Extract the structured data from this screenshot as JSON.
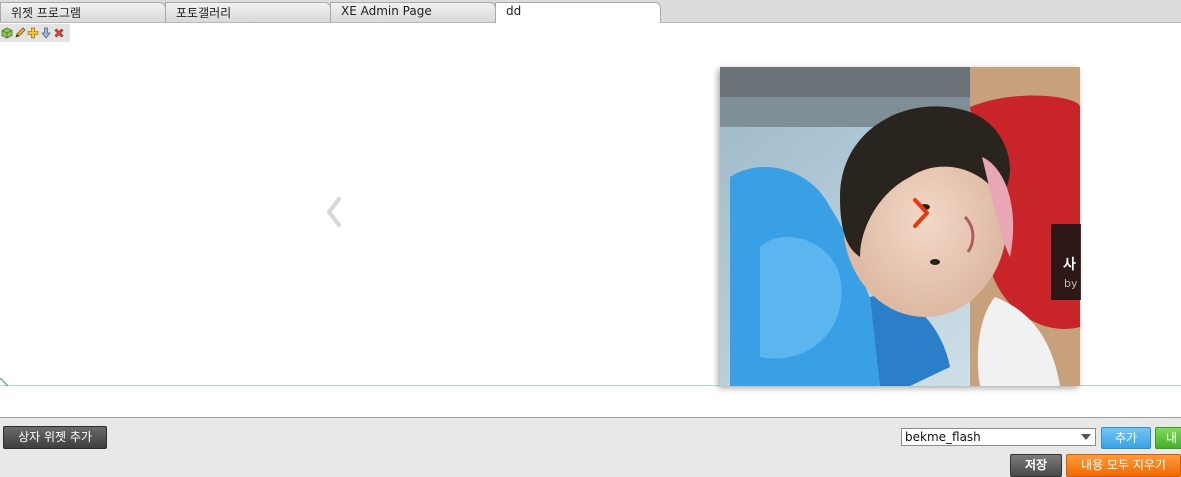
{
  "tabs": [
    {
      "label": "위젯 프로그램"
    },
    {
      "label": "포토갤러리"
    },
    {
      "label": "XE Admin Page"
    },
    {
      "label": "dd"
    }
  ],
  "widget_toolbar": {
    "icons": [
      "widget-style-icon",
      "edit-pencil-icon",
      "add-plus-icon",
      "move-down-icon",
      "delete-x-icon"
    ]
  },
  "slider": {
    "caption_title": "사",
    "caption_by": "by",
    "colors": {
      "arrow_right": "#e8380d",
      "caption_bg": "#141414"
    }
  },
  "bottom": {
    "add_box_widget_label": "상자 위젯 추가",
    "widget_select_value": "bekme_flash",
    "add_label": "추가",
    "green_label": "내",
    "save_label": "저장",
    "clear_all_label": "내용 모두 지우기"
  },
  "colors": {
    "add_button": "#3aa3e4",
    "green_button": "#43b12a",
    "clear_button": "#f06a00",
    "save_button": "#4a4a4a"
  }
}
